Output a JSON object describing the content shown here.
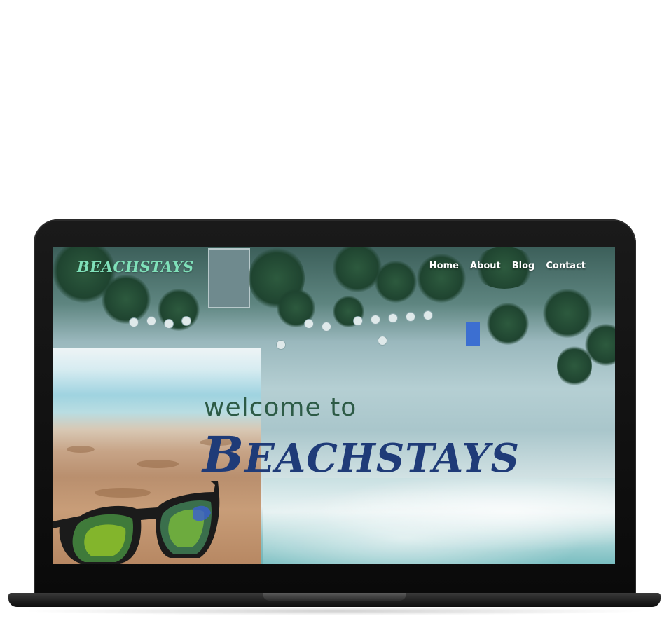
{
  "site": {
    "logo": "BEACHSTAYS",
    "nav": [
      {
        "label": "Home"
      },
      {
        "label": "About"
      },
      {
        "label": "Blog"
      },
      {
        "label": "Contact"
      }
    ]
  },
  "hero": {
    "welcome": "welcome to",
    "brand_first": "B",
    "brand_rest": "EACHSTAYS"
  },
  "colors": {
    "logo": "#7fe0b9",
    "welcome": "#2d5b46",
    "brand": "#1f3b78"
  }
}
